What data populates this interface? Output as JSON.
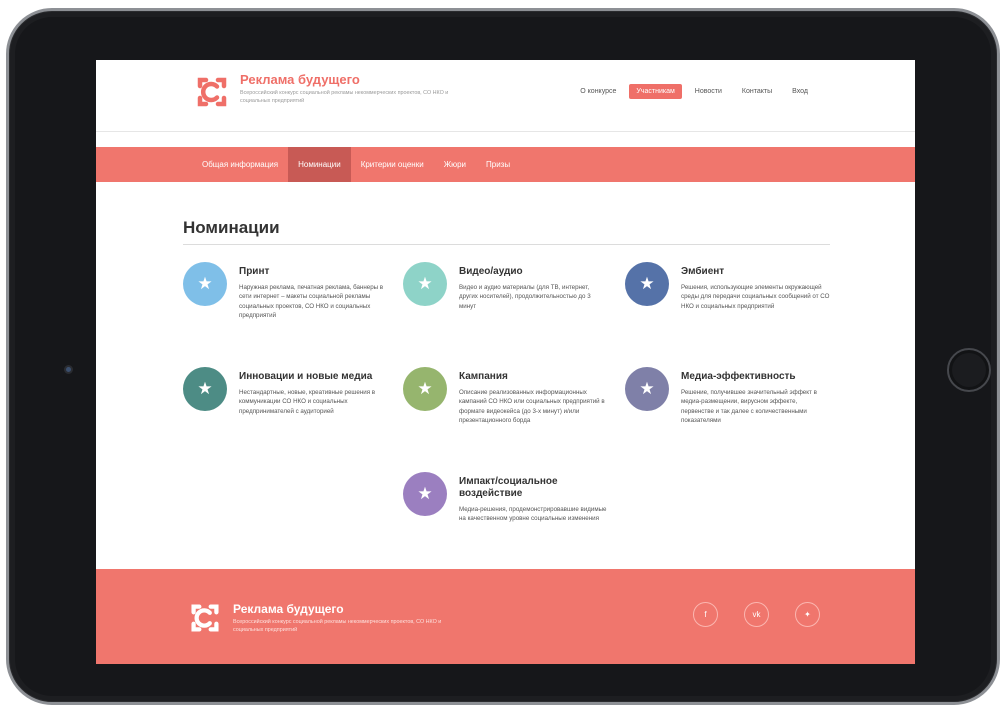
{
  "brand": {
    "name": "Реклама будущего",
    "subtitle": "Всероссийский конкурс социальной рекламы некоммерческих проектов, СО НКО и социальных предприятий"
  },
  "topnav": [
    {
      "label": "О конкурсе",
      "active": false
    },
    {
      "label": "Участникам",
      "active": true
    },
    {
      "label": "Новости",
      "active": false
    },
    {
      "label": "Контакты",
      "active": false
    },
    {
      "label": "Вход",
      "active": false
    }
  ],
  "tabs": [
    {
      "label": "Общая информация",
      "active": false
    },
    {
      "label": "Номинации",
      "active": true
    },
    {
      "label": "Критерии оценки",
      "active": false
    },
    {
      "label": "Жюри",
      "active": false
    },
    {
      "label": "Призы",
      "active": false
    }
  ],
  "page_title": "Номинации",
  "nominations": [
    {
      "title": "Принт",
      "desc": "Наружная реклама, печатная реклама, баннеры в сети интернет – макеты социальной рекламы социальных проектов, СО НКО и социальных предприятий",
      "color": "#7fbfe8",
      "icon": "star-icon"
    },
    {
      "title": "Видео/аудио",
      "desc": "Видео и аудио материалы (для ТВ, интернет, других носителей), продолжительностью до 3 минут",
      "color": "#8ed3c8",
      "icon": "star-icon"
    },
    {
      "title": "Эмбиент",
      "desc": "Решения, использующие элементы окружающей среды для передачи социальных сообщений от СО НКО и социальных предприятий",
      "color": "#5572a8",
      "icon": "star-icon"
    },
    {
      "title": "Инновации и новые медиа",
      "desc": "Нестандартные, новые, креативные решения в коммуникации СО НКО и социальных предпринимателей с аудиторией",
      "color": "#4d8c85",
      "icon": "star-icon"
    },
    {
      "title": "Кампания",
      "desc": "Описание реализованных информационных кампаний СО НКО или социальных предприятий в формате видеокейса (до 3-х минут) и/или презентационного борда",
      "color": "#96b56e",
      "icon": "star-icon"
    },
    {
      "title": "Медиа-эффективность",
      "desc": "Решение, получившее значительный эффект в медиа-размещении, вирусном эффекте, первенстве и так далее с количественными показателями",
      "color": "#7f80a8",
      "icon": "star-icon"
    },
    {
      "title": "Импакт/социальное воздействие",
      "desc": "Медиа-решения, продемонстрировавшие видимые на качественном уровне социальные изменения",
      "color": "#9b7fc0",
      "icon": "star-icon"
    }
  ],
  "footer": {
    "name": "Реклама будущего",
    "subtitle": "Всероссийский конкурс социальной рекламы некоммерческих проектов, СО НКО и социальных предприятий",
    "social": [
      {
        "label": "f",
        "icon": "facebook-icon"
      },
      {
        "label": "vk",
        "icon": "vk-icon"
      },
      {
        "label": "✦",
        "icon": "twitter-icon"
      }
    ]
  },
  "colors": {
    "accent": "#f0766d",
    "accent_dark": "#c85a55",
    "brand_text": "#ef6f68"
  }
}
